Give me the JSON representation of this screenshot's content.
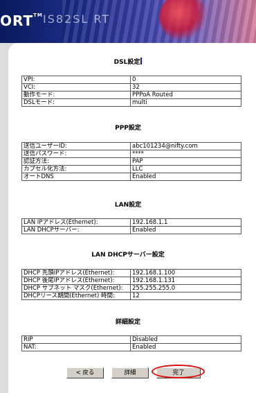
{
  "header": {
    "logo_text": "ORT",
    "logo_mark": "TM",
    "sub_text": "IS82SL RT"
  },
  "sections": {
    "dsl": {
      "title": "DSL設定",
      "rows": [
        {
          "k": "VPI:",
          "v": "0"
        },
        {
          "k": "VCI:",
          "v": "32"
        },
        {
          "k": "動作モード:",
          "v": "PPPoA Routed"
        },
        {
          "k": "DSLモード:",
          "v": "multi"
        }
      ]
    },
    "ppp": {
      "title": "PPP設定",
      "rows": [
        {
          "k": "送信ユーザーID:",
          "v": "abc101234@nifty.com"
        },
        {
          "k": "送信パスワード:",
          "v": "****"
        },
        {
          "k": "認証方法:",
          "v": "PAP"
        },
        {
          "k": "カプセル化方法:",
          "v": "LLC"
        },
        {
          "k": "オートDNS",
          "v": "Enabled"
        }
      ]
    },
    "lan": {
      "title": "LAN設定",
      "rows": [
        {
          "k": "LAN IPアドレス(Ethernet):",
          "v": "192.168.1.1"
        },
        {
          "k": "LAN DHCPサーバー:",
          "v": "Enabled"
        }
      ]
    },
    "dhcp": {
      "title": "LAN DHCPサーバー設定",
      "rows": [
        {
          "k": "DHCP 先頭IPアドレス(Ethernet):",
          "v": "192.168.1.100"
        },
        {
          "k": "DHCP 後尾IPアドレス(Ethernet):",
          "v": "192.168.1.131"
        },
        {
          "k": "DHCP サブネット マスク(Ethernet):",
          "v": "255.255.255.0"
        },
        {
          "k": "DHCPリース期間(Ethernet) 時間:",
          "v": "12"
        }
      ]
    },
    "detail": {
      "title": "詳細設定",
      "rows": [
        {
          "k": "RIP",
          "v": "Disabled"
        },
        {
          "k": "NAT:",
          "v": "Enabled"
        }
      ]
    }
  },
  "buttons": {
    "back": "< 戻る",
    "detail": "詳細",
    "finish": "完了"
  },
  "colors": {
    "highlight_ring": "#e01010"
  }
}
